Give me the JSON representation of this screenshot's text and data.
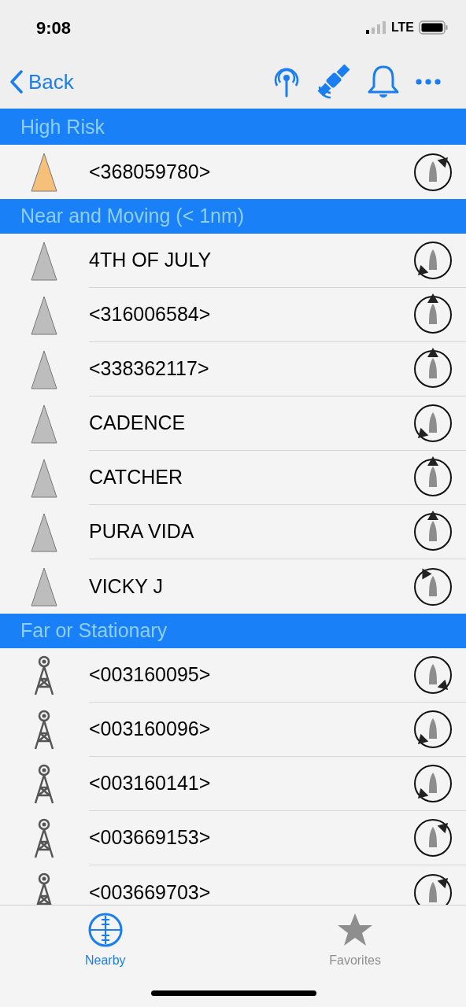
{
  "status_bar": {
    "time": "9:08",
    "network": "LTE"
  },
  "nav": {
    "back": "Back"
  },
  "sections": [
    {
      "title": "High Risk",
      "rows": [
        {
          "kind": "vessel",
          "color": "#f7c07a",
          "name": "<368059780>",
          "compass": {
            "kind": "ne"
          }
        }
      ]
    },
    {
      "title": "Near and Moving (< 1nm)",
      "rows": [
        {
          "kind": "vessel",
          "color": "#bdbdbd",
          "name": "4TH OF JULY",
          "compass": {
            "kind": "sw"
          }
        },
        {
          "kind": "vessel",
          "color": "#bdbdbd",
          "name": "<316006584>",
          "compass": {
            "kind": "n"
          }
        },
        {
          "kind": "vessel",
          "color": "#bdbdbd",
          "name": "<338362117>",
          "compass": {
            "kind": "n"
          }
        },
        {
          "kind": "vessel",
          "color": "#bdbdbd",
          "name": "CADENCE",
          "compass": {
            "kind": "sw"
          }
        },
        {
          "kind": "vessel",
          "color": "#bdbdbd",
          "name": "CATCHER",
          "compass": {
            "kind": "n"
          }
        },
        {
          "kind": "vessel",
          "color": "#bdbdbd",
          "name": "PURA VIDA",
          "compass": {
            "kind": "n"
          }
        },
        {
          "kind": "vessel",
          "color": "#bdbdbd",
          "name": "VICKY J",
          "compass": {
            "kind": "nw"
          }
        }
      ]
    },
    {
      "title": "Far or Stationary",
      "rows": [
        {
          "kind": "station",
          "name": "<003160095>",
          "compass": {
            "kind": "se"
          }
        },
        {
          "kind": "station",
          "name": "<003160096>",
          "compass": {
            "kind": "sw"
          }
        },
        {
          "kind": "station",
          "name": "<003160141>",
          "compass": {
            "kind": "sw"
          }
        },
        {
          "kind": "station",
          "name": "<003669153>",
          "compass": {
            "kind": "ne"
          }
        },
        {
          "kind": "station",
          "name": "<003669703>",
          "compass": {
            "kind": "ne"
          }
        }
      ]
    }
  ],
  "tabs": [
    {
      "label": "Nearby",
      "selected": true
    },
    {
      "label": "Favorites",
      "selected": false
    }
  ]
}
